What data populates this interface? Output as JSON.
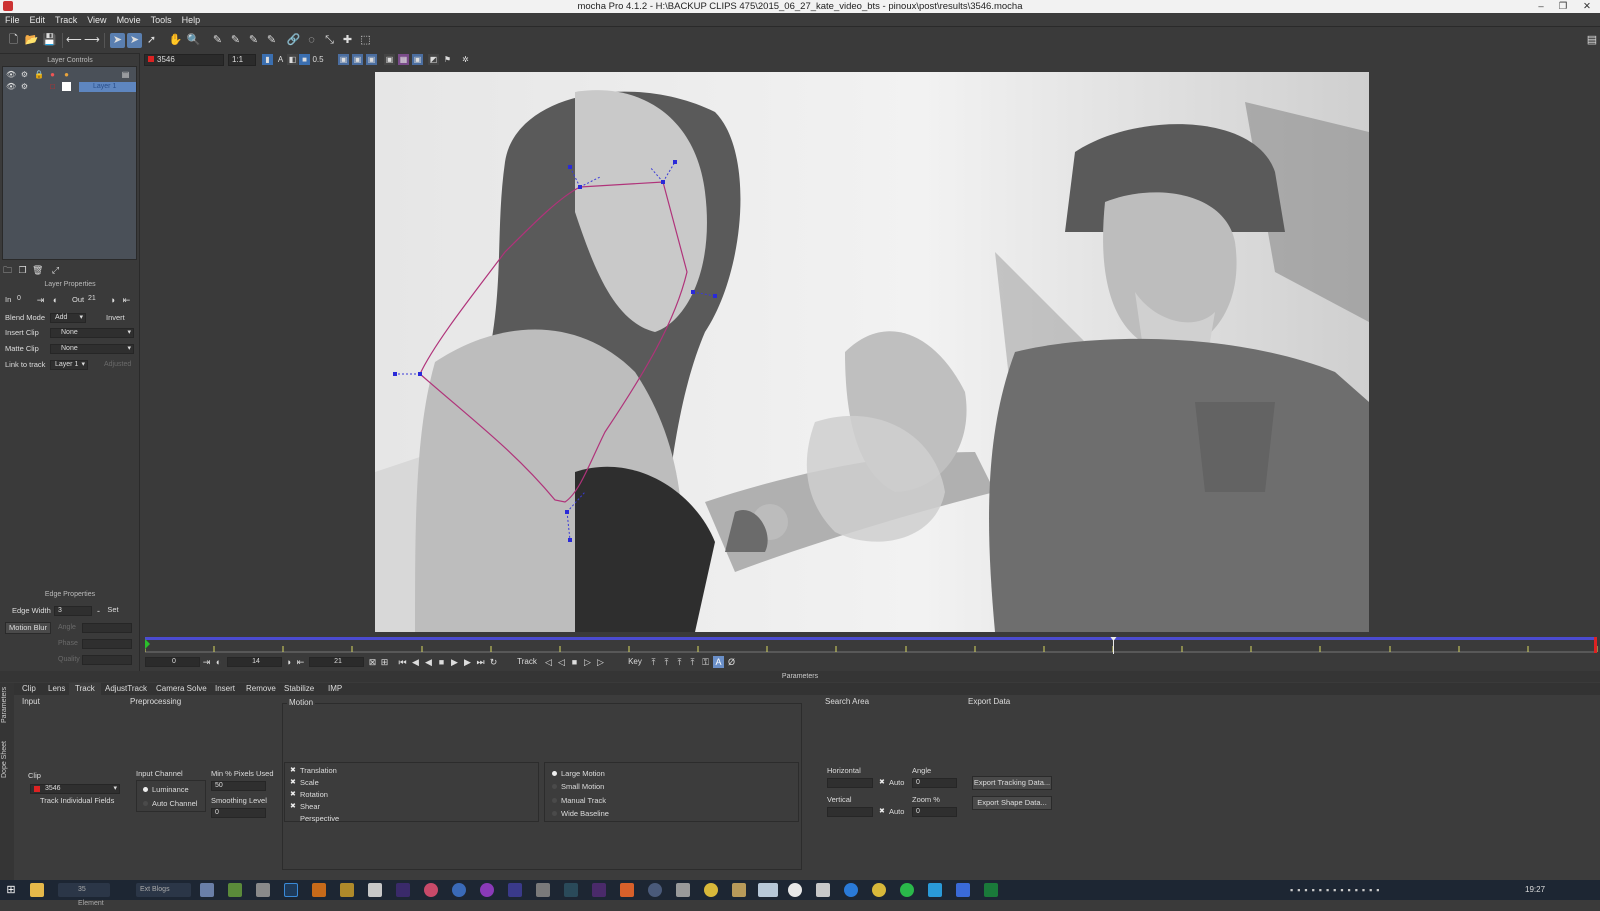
{
  "window": {
    "title": "mocha Pro 4.1.2 - H:\\BACKUP CLIPS 475\\2015_06_27_kate_video_bts - pinoux\\post\\results\\3546.mocha",
    "min": "‒",
    "max": "❐",
    "close": "✕"
  },
  "menu": [
    "File",
    "Edit",
    "Track",
    "View",
    "Movie",
    "Tools",
    "Help"
  ],
  "viewbar": {
    "clip": "3546",
    "zoom": "1:1",
    "alpha": "A",
    "opacity": "0.5"
  },
  "layer_controls": {
    "header": "Layer Controls",
    "layer_name": "Layer 1"
  },
  "layer_properties": {
    "header": "Layer Properties",
    "in_label": "In",
    "in_value": "0",
    "out_label": "Out",
    "out_value": "21",
    "blend_mode_label": "Blend Mode",
    "blend_mode_value": "Add",
    "invert_label": "Invert",
    "insert_clip_label": "Insert Clip",
    "insert_clip_value": "None",
    "matte_clip_label": "Matte Clip",
    "matte_clip_value": "None",
    "link_label": "Link to track",
    "link_value": "Layer 1",
    "adjusted_label": "Adjusted"
  },
  "edge_properties": {
    "header": "Edge Properties",
    "edge_width_label": "Edge Width",
    "edge_width_value": "3",
    "set_label": "Set",
    "motion_blur_label": "Motion Blur",
    "angle_label": "Angle",
    "angle_value": "",
    "phase_label": "Phase",
    "phase_value": "",
    "quality_label": "Quality",
    "quality_value": ""
  },
  "timeline": {
    "start": "0",
    "current": "14",
    "end": "21",
    "track_label": "Track",
    "key_label": "Key",
    "current_fraction": 0.667
  },
  "parameters": {
    "title": "Parameters",
    "side_tabs": [
      "Parameters",
      "Dope Sheet"
    ],
    "tabs": [
      "Clip",
      "Lens",
      "Track",
      "AdjustTrack",
      "Camera Solve",
      "Insert",
      "Remove",
      "Stabilize",
      "IMP"
    ],
    "active_tab": "Track",
    "input": {
      "title": "Input",
      "clip_label": "Clip",
      "clip_value": "3546",
      "track_individual": "Track Individual Fields"
    },
    "preprocessing": {
      "title": "Preprocessing",
      "input_channel_label": "Input Channel",
      "luminance": "Luminance",
      "auto_channel": "Auto Channel",
      "min_pixels_label": "Min % Pixels Used",
      "min_pixels_value": "50",
      "smoothing_label": "Smoothing Level",
      "smoothing_value": "0"
    },
    "motion": {
      "title": "Motion",
      "translation": "Translation",
      "scale": "Scale",
      "rotation": "Rotation",
      "shear": "Shear",
      "perspective": "Perspective",
      "large_motion": "Large Motion",
      "small_motion": "Small Motion",
      "manual_track": "Manual Track",
      "wide_baseline": "Wide Baseline"
    },
    "search_area": {
      "title": "Search Area",
      "horizontal_label": "Horizontal",
      "vertical_label": "Vertical",
      "auto_label": "Auto",
      "angle_label": "Angle",
      "angle_value": "0",
      "zoom_label": "Zoom %",
      "zoom_value": "0"
    },
    "export_data": {
      "title": "Export Data",
      "export_tracking": "Export Tracking Data...",
      "export_shape": "Export Shape Data..."
    }
  },
  "taskbar": {
    "clock": "19:27",
    "item1": "35 Element",
    "item2": "Ext Blogs"
  }
}
